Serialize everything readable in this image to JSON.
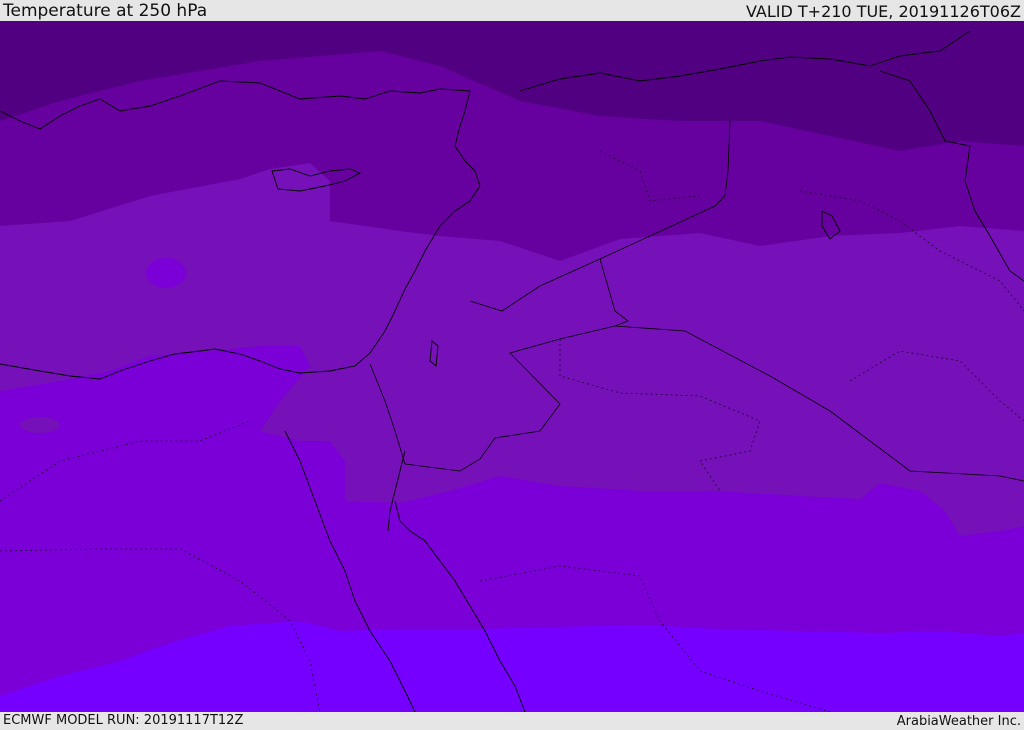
{
  "header": {
    "title": "Temperature at 250 hPa",
    "valid_time": "VALID T+210 TUE, 20191126T06Z"
  },
  "footer": {
    "model_run": "ECMWF MODEL RUN: 20191117T12Z",
    "provider": "ArabiaWeather Inc."
  },
  "map": {
    "field": "temperature_250hPa",
    "colors": {
      "band_1": "#520082",
      "band_2": "#66009e",
      "band_3": "#7610b8",
      "band_4": "#7b00d8",
      "band_5": "#7500ff",
      "coastline": "#000000",
      "border": "#1a0030"
    }
  }
}
